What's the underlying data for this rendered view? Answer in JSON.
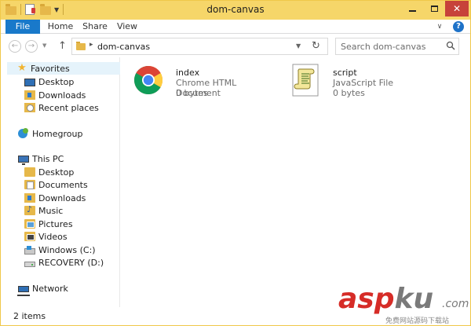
{
  "window": {
    "title": "dom-canvas"
  },
  "ribbon": {
    "tabs": [
      {
        "label": "File"
      },
      {
        "label": "Home"
      },
      {
        "label": "Share"
      },
      {
        "label": "View"
      }
    ],
    "help_label": "?"
  },
  "address": {
    "path": "dom-canvas",
    "search_placeholder": "Search dom-canvas"
  },
  "navpane": {
    "favorites": {
      "label": "Favorites",
      "items": [
        {
          "label": "Desktop",
          "icon": "desktop-icon"
        },
        {
          "label": "Downloads",
          "icon": "downloads-folder-icon"
        },
        {
          "label": "Recent places",
          "icon": "recent-places-icon"
        }
      ]
    },
    "homegroup": {
      "label": "Homegroup"
    },
    "this_pc": {
      "label": "This PC",
      "items": [
        {
          "label": "Desktop",
          "icon": "folder-icon"
        },
        {
          "label": "Documents",
          "icon": "documents-folder-icon"
        },
        {
          "label": "Downloads",
          "icon": "downloads-folder-icon"
        },
        {
          "label": "Music",
          "icon": "music-folder-icon"
        },
        {
          "label": "Pictures",
          "icon": "pictures-folder-icon"
        },
        {
          "label": "Videos",
          "icon": "videos-folder-icon"
        },
        {
          "label": "Windows (C:)",
          "icon": "windows-drive-icon"
        },
        {
          "label": "RECOVERY (D:)",
          "icon": "drive-icon"
        }
      ]
    },
    "network": {
      "label": "Network"
    }
  },
  "files": [
    {
      "name": "index",
      "type": "Chrome HTML Document",
      "size": "0 bytes",
      "icon": "chrome-icon"
    },
    {
      "name": "script",
      "type": "JavaScript File",
      "size": "0 bytes",
      "icon": "script-file-icon"
    }
  ],
  "status": {
    "item_count": "2 items"
  },
  "watermark": {
    "brand_red": "asp",
    "brand_gray": "ku",
    "suffix": ".com",
    "tagline": "免费网站源码下载站"
  },
  "colors": {
    "titlebar": "#f6d669",
    "file_tab": "#1979ca",
    "selected_nav": "#e5f3fb",
    "close_button": "#c7423a"
  }
}
